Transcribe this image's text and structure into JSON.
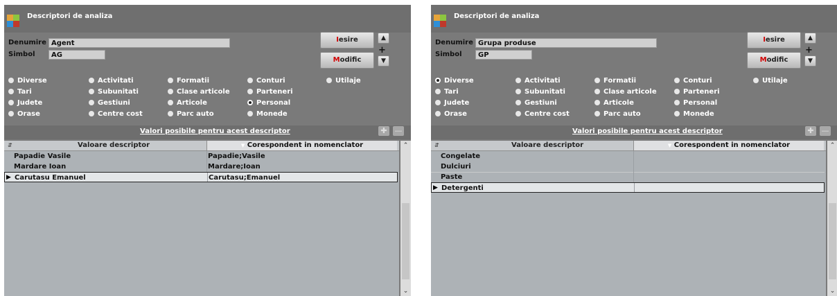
{
  "windows": [
    {
      "title": "Descriptori de analiza",
      "denumire_label": "Denumire",
      "denumire_value": "Agent",
      "simbol_label": "Simbol",
      "simbol_value": "AG",
      "iesire_prefix": "I",
      "iesire_rest": "esire",
      "modific_prefix": "M",
      "modific_rest": "odific",
      "radios": [
        "Diverse",
        "Activitati",
        "Formatii",
        "Conturi",
        "Utilaje",
        "Tari",
        "Subunitati",
        "Clase articole",
        "Parteneri",
        "Judete",
        "Gestiuni",
        "Articole",
        "Personal",
        "Orase",
        "Centre cost",
        "Parc auto",
        "Monede"
      ],
      "selected_radio": "Personal",
      "values_title": "Valori posibile pentru acest descriptor",
      "col1": "Valoare descriptor",
      "col2": "Corespondent in nomenclator",
      "rows": [
        {
          "v": "Papadie Vasile",
          "c": "Papadie;Vasile"
        },
        {
          "v": "Mardare Ioan",
          "c": "Mardare;Ioan"
        },
        {
          "v": "Carutasu Emanuel",
          "c": "Carutasu;Emanuel"
        }
      ],
      "selected_row": 2
    },
    {
      "title": "Descriptori de analiza",
      "denumire_label": "Denumire",
      "denumire_value": "Grupa produse",
      "simbol_label": "Simbol",
      "simbol_value": "GP",
      "iesire_prefix": "I",
      "iesire_rest": "esire",
      "modific_prefix": "M",
      "modific_rest": "odific",
      "radios": [
        "Diverse",
        "Activitati",
        "Formatii",
        "Conturi",
        "Utilaje",
        "Tari",
        "Subunitati",
        "Clase articole",
        "Parteneri",
        "Judete",
        "Gestiuni",
        "Articole",
        "Personal",
        "Orase",
        "Centre cost",
        "Parc auto",
        "Monede"
      ],
      "selected_radio": "Diverse",
      "values_title": "Valori posibile pentru acest descriptor",
      "col1": "Valoare descriptor",
      "col2": "Corespondent in nomenclator",
      "rows": [
        {
          "v": "Congelate",
          "c": ""
        },
        {
          "v": "Dulciuri",
          "c": ""
        },
        {
          "v": "Paste",
          "c": ""
        },
        {
          "v": "Detergenti",
          "c": ""
        }
      ],
      "selected_row": 3
    }
  ],
  "icons": {
    "sort": "sort-updown-icon",
    "col_sort": "sort-down-icon",
    "row_pointer": "row-pointer-icon",
    "add": "add-icon",
    "remove": "remove-icon",
    "spin_up": "arrow-up-icon",
    "spin_plus": "plus-icon",
    "spin_down": "arrow-down-icon",
    "scroll_up": "chevron-up-icon",
    "scroll_down": "chevron-down-icon"
  }
}
